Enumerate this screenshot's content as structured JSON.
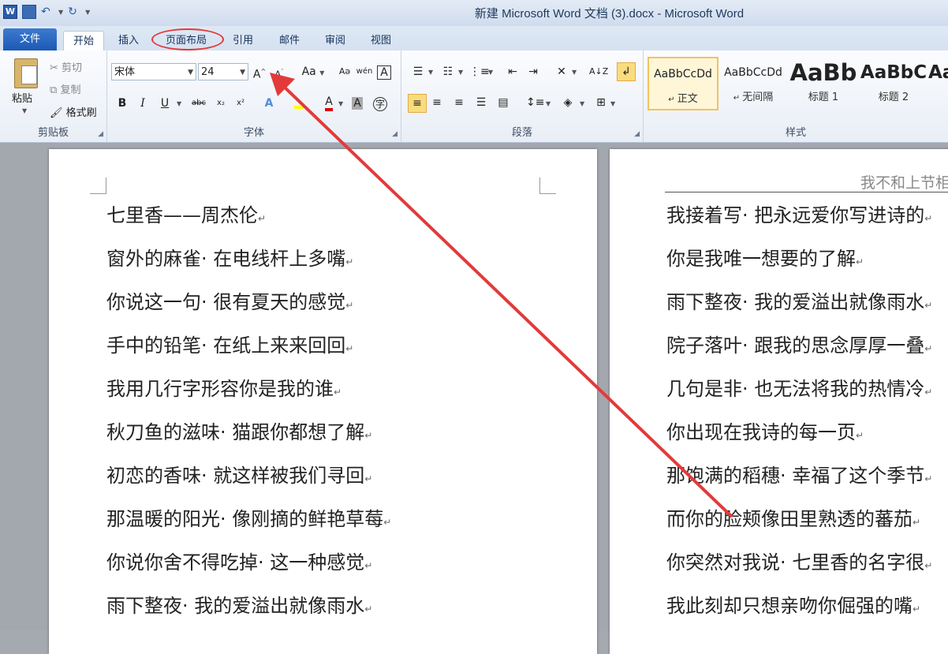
{
  "window": {
    "title": "新建 Microsoft Word 文档 (3).docx - Microsoft Word"
  },
  "tabs": [
    "文件",
    "开始",
    "插入",
    "页面布局",
    "引用",
    "邮件",
    "审阅",
    "视图"
  ],
  "clipboard": {
    "paste": "粘贴",
    "cut": "剪切",
    "copy": "复制",
    "format_painter": "格式刷",
    "label": "剪贴板"
  },
  "font": {
    "name": "宋体",
    "size": "24",
    "label": "字体",
    "grow": "A",
    "shrink": "A",
    "case": "Aa",
    "bold": "B",
    "italic": "I",
    "underline": "U",
    "strike": "abc",
    "sub": "x₂",
    "super": "x²",
    "pinyin": "wén",
    "border_char": "A",
    "effects": "A",
    "color": "A",
    "shading": "A",
    "enclose": "字"
  },
  "paragraph": {
    "label": "段落"
  },
  "styles": {
    "label": "样式",
    "items": [
      {
        "sample": "AaBbCcDd",
        "name": "正文"
      },
      {
        "sample": "AaBbCcDd",
        "name": "无间隔"
      },
      {
        "sample": "AaBb",
        "name": "标题 1"
      },
      {
        "sample": "AaBbC",
        "name": "标题 2"
      },
      {
        "sample": "Aa",
        "name": ""
      }
    ]
  },
  "document": {
    "page1_lines": [
      "七里香——周杰伦",
      "窗外的麻雀· 在电线杆上多嘴",
      "你说这一句· 很有夏天的感觉",
      "手中的铅笔· 在纸上来来回回",
      "我用几行字形容你是我的谁",
      "秋刀鱼的滋味· 猫跟你都想了解",
      "初恋的香味· 就这样被我们寻回",
      "那温暖的阳光· 像刚摘的鲜艳草莓",
      "你说你舍不得吃掉· 这一种感觉",
      "雨下整夜· 我的爱溢出就像雨水"
    ],
    "page2_header": "我不和上节相连啊",
    "page2_lines": [
      "我接着写· 把永远爱你写进诗的",
      "你是我唯一想要的了解",
      "雨下整夜· 我的爱溢出就像雨水",
      "院子落叶· 跟我的思念厚厚一叠",
      "几句是非· 也无法将我的热情冷",
      "你出现在我诗的每一页",
      "那饱满的稻穗· 幸福了这个季节",
      "而你的脸颊像田里熟透的蕃茄",
      "你突然对我说· 七里香的名字很",
      "我此刻却只想亲吻你倔强的嘴"
    ],
    "paragraph_mark": "↵"
  },
  "annotation": {
    "color": "#e23a3a"
  }
}
